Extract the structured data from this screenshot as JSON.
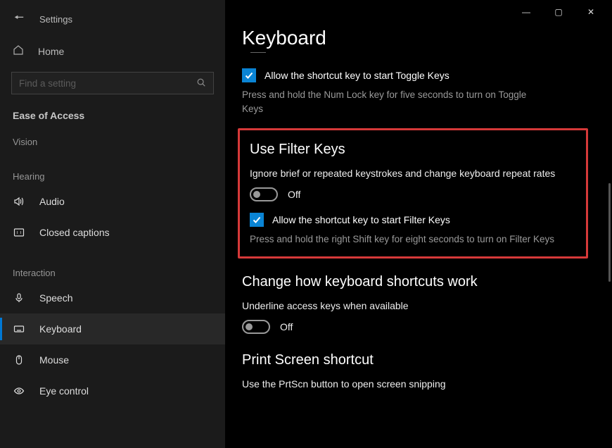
{
  "window": {
    "title": "Settings",
    "controls": {
      "min": "—",
      "max": "▢",
      "close": "✕"
    }
  },
  "sidebar": {
    "home_label": "Home",
    "search_placeholder": "Find a setting",
    "active_group": "Ease of Access",
    "groups": [
      {
        "label": "Vision",
        "items": []
      },
      {
        "label": "Hearing",
        "items": [
          {
            "key": "audio",
            "label": "Audio",
            "icon": "volume-icon"
          },
          {
            "key": "cc",
            "label": "Closed captions",
            "icon": "captions-icon"
          }
        ]
      },
      {
        "label": "Interaction",
        "items": [
          {
            "key": "speech",
            "label": "Speech",
            "icon": "mic-icon"
          },
          {
            "key": "keyboard",
            "label": "Keyboard",
            "icon": "keyboard-icon",
            "active": true
          },
          {
            "key": "mouse",
            "label": "Mouse",
            "icon": "mouse-icon"
          },
          {
            "key": "eye",
            "label": "Eye control",
            "icon": "eye-icon"
          }
        ]
      }
    ]
  },
  "page": {
    "title": "Keyboard",
    "toggle_keys": {
      "checkbox_label": "Allow the shortcut key to start Toggle Keys",
      "help": "Press and hold the Num Lock key for five seconds to turn on Toggle Keys"
    },
    "filter_keys": {
      "heading": "Use Filter Keys",
      "desc": "Ignore brief or repeated keystrokes and change keyboard repeat rates",
      "toggle_state": "Off",
      "checkbox_label": "Allow the shortcut key to start Filter Keys",
      "help": "Press and hold the right Shift key for eight seconds to turn on Filter Keys"
    },
    "shortcuts": {
      "heading": "Change how keyboard shortcuts work",
      "desc": "Underline access keys when available",
      "toggle_state": "Off"
    },
    "printscreen": {
      "heading": "Print Screen shortcut",
      "desc": "Use the PrtScn button to open screen snipping"
    }
  }
}
